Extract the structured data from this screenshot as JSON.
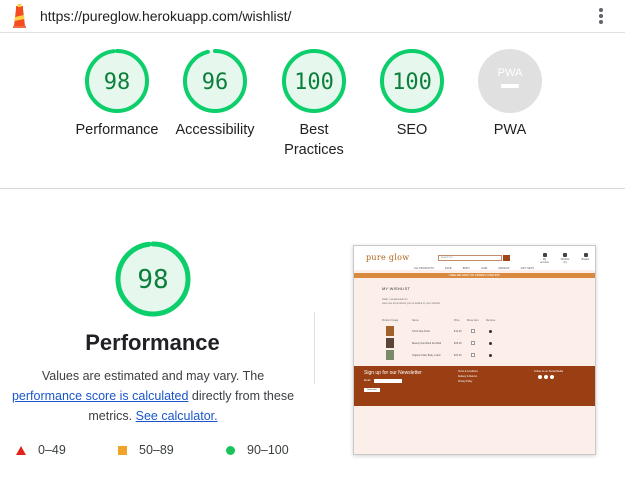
{
  "browser": {
    "url": "https://pureglow.herokuapp.com/wishlist/"
  },
  "colors": {
    "pass": "#0cce6b",
    "pass_text": "#0c7f3a",
    "average": "#ffa400",
    "fail": "#ff4e42",
    "na": "#e0e0e0",
    "link": "#1a56c9"
  },
  "gauges": [
    {
      "score": "98",
      "label": "Performance",
      "fraction": 0.98
    },
    {
      "score": "96",
      "label": "Accessibility",
      "fraction": 0.96
    },
    {
      "score": "100",
      "label": "Best Practices",
      "fraction": 1.0
    },
    {
      "score": "100",
      "label": "SEO",
      "fraction": 1.0
    },
    {
      "score": "",
      "label": "PWA",
      "badge": "PWA"
    }
  ],
  "detail": {
    "score": "98",
    "fraction": 0.98,
    "title": "Performance",
    "desc_before": "Values are estimated and may vary. The ",
    "desc_link1": "performance score is calculated",
    "desc_mid": " directly from these metrics. ",
    "desc_link2": "See calculator."
  },
  "legend": [
    {
      "shape": "triangle",
      "range": "0–49"
    },
    {
      "shape": "square",
      "range": "50–89"
    },
    {
      "shape": "circle",
      "range": "90–100"
    }
  ],
  "thumbnail": {
    "brand": "pure glow",
    "search_placeholder": "Search for ...",
    "icons": [
      "My account",
      "Wishlist (0)",
      "Basket"
    ],
    "nav": [
      "ALL PRODUCTS",
      "FACE",
      "BODY",
      "HAIR",
      "MAKEUP",
      "GIFT SETS"
    ],
    "banner": "FREE DELIVERY ON ORDERS OVER €50!",
    "heading": "MY WISHLIST",
    "intro": [
      "Hello, mariasavasimm",
      "Here are all products you've added to your wishlist"
    ],
    "table_headers": [
      "Product Image",
      "Name",
      "Price",
      "Move Item",
      "Remove"
    ],
    "rows": [
      {
        "name": "Torrid Spa Drink",
        "price": "€14.00",
        "img": "#a0612a"
      },
      {
        "name": "Beauty Dumbbell Set Bold",
        "price": "€26.00",
        "img": "#5a4636"
      },
      {
        "name": "Organic Daily Body Lotion",
        "price": "€22.00",
        "img": "#7a8a6a"
      }
    ],
    "footer_title": "Sign up for our Newsletter",
    "footer_email": "Email",
    "footer_button": "Subscribe",
    "footer_links": [
      "Terms & Conditions",
      "Delivery & Returns",
      "Privacy Policy"
    ],
    "footer_follow": "Follow us on Social Media"
  }
}
